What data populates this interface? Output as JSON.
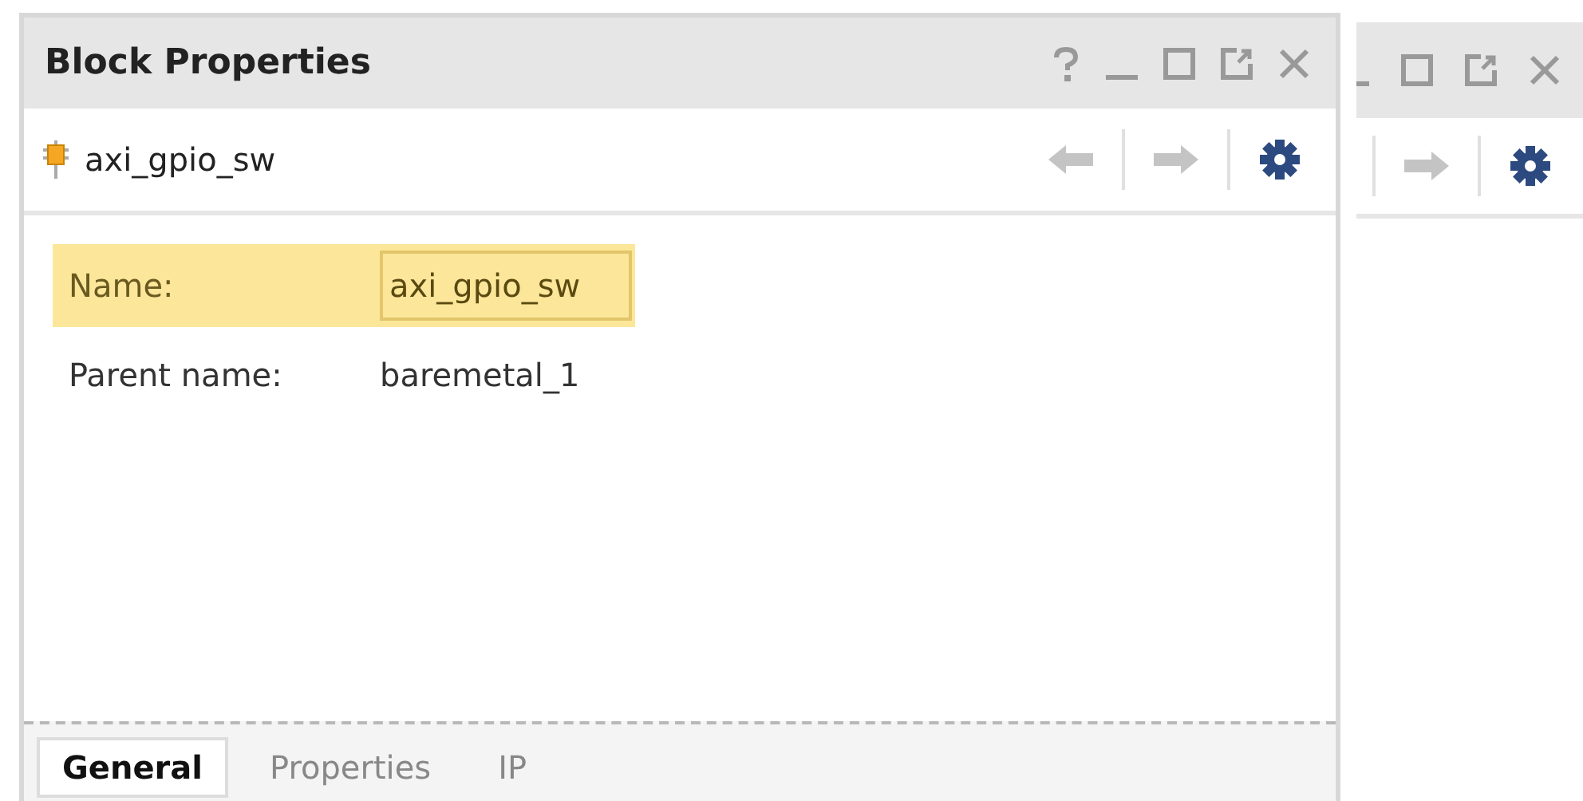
{
  "panel": {
    "title": "Block Properties",
    "object_name": "axi_gpio_sw"
  },
  "properties": [
    {
      "label": "Name:",
      "value": "axi_gpio_sw",
      "kind": "field",
      "highlighted": true
    },
    {
      "label": "Parent name:",
      "value": "baremetal_1",
      "kind": "text",
      "highlighted": false
    }
  ],
  "tabs": [
    {
      "label": "General",
      "selected": true
    },
    {
      "label": "Properties",
      "selected": false
    },
    {
      "label": "IP",
      "selected": false
    }
  ]
}
